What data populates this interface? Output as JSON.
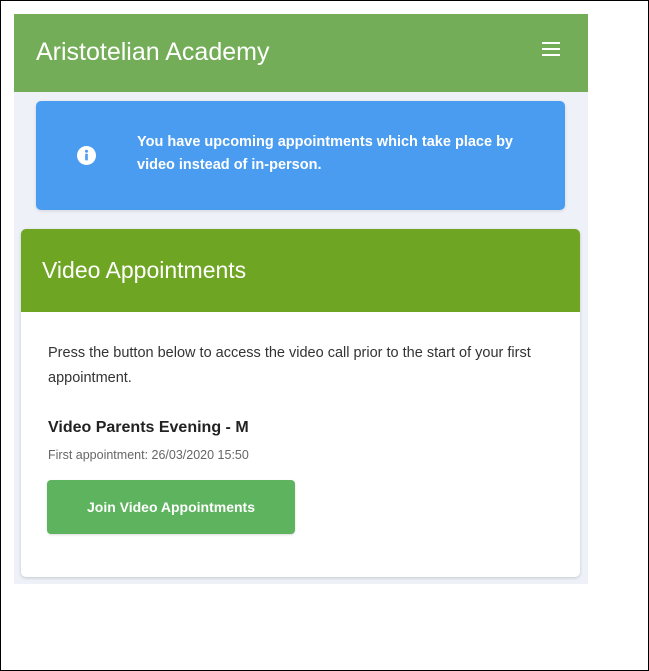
{
  "navbar": {
    "brand": "Aristotelian Academy",
    "menu_icon": "hamburger-menu-icon"
  },
  "alert": {
    "icon": "info-circle-icon",
    "message": "You have upcoming appointments which take place by video instead of in-person."
  },
  "card": {
    "title": "Video Appointments",
    "description": "Press the button below to access the video call prior to the start of your first appointment.",
    "event_title": "Video Parents Evening - M",
    "event_meta": "First appointment: 26/03/2020 15:50",
    "button_label": "Join Video Appointments"
  },
  "colors": {
    "navbar": "#73ad57",
    "alert": "#4a9cf0",
    "card_header": "#6ea522",
    "button": "#5eb35e",
    "background": "#eef2f8"
  }
}
